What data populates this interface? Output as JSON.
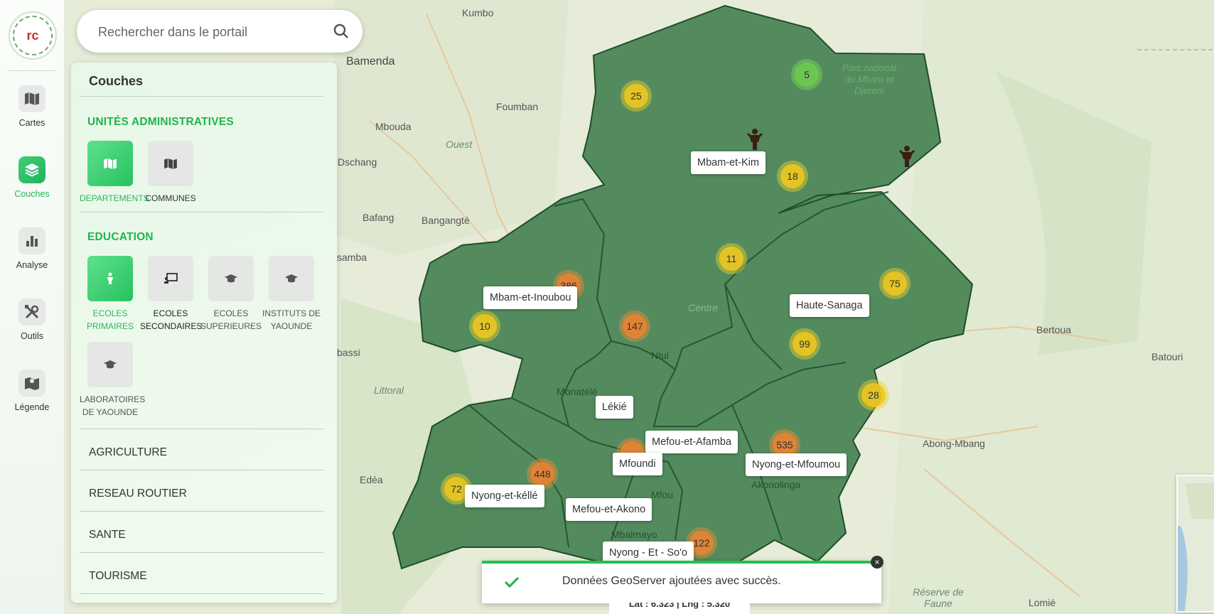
{
  "search": {
    "placeholder": "Rechercher dans le portail"
  },
  "nav": [
    {
      "label": "Cartes",
      "icon": "map-icon",
      "active": false
    },
    {
      "label": "Couches",
      "icon": "layers-icon",
      "active": true
    },
    {
      "label": "Analyse",
      "icon": "bar-chart-icon",
      "active": false
    },
    {
      "label": "Outils",
      "icon": "tools-icon",
      "active": false
    },
    {
      "label": "Légende",
      "icon": "legend-map-icon",
      "active": false
    }
  ],
  "panel": {
    "title": "Couches",
    "admin": {
      "title": "UNITÉS ADMINISTRATIVES",
      "items": [
        {
          "label": "DEPARTEMENTS",
          "icon": "map-icon",
          "active": true
        },
        {
          "label": "COMMUNES",
          "icon": "map-icon",
          "active": false
        }
      ]
    },
    "education": {
      "title": "EDUCATION",
      "items": [
        {
          "label": "ECOLES PRIMAIRES",
          "icon": "child-icon",
          "active": true
        },
        {
          "label": "ECOLES SECONDAIRES",
          "icon": "teacher-board-icon",
          "active": false
        },
        {
          "label": "ECOLES SUPERIEURES",
          "icon": "graduation-cap-icon",
          "active": false
        },
        {
          "label": "INSTITUTS DE YAOUNDE",
          "icon": "graduation-cap-icon",
          "active": false
        },
        {
          "label": "LABORATOIRES DE YAOUNDE",
          "icon": "graduation-cap-icon",
          "active": false
        }
      ]
    },
    "categories": [
      "AGRICULTURE",
      "RESEAU ROUTIER",
      "SANTE",
      "TOURISME"
    ]
  },
  "map": {
    "departments": [
      "Mbam-et-Kim",
      "Mbam-et-Inoubou",
      "Haute-Sanaga",
      "Lékié",
      "Mefou-et-Afamba",
      "Mfoundi",
      "Nyong-et-Mfoumou",
      "Nyong-et-kéllé",
      "Mefou-et-Akono",
      "Nyong - Et - So'o"
    ],
    "clusters": [
      {
        "value": "25",
        "level": "yellow"
      },
      {
        "value": "5",
        "level": "green"
      },
      {
        "value": "18",
        "level": "yellow"
      },
      {
        "value": "11",
        "level": "yellow"
      },
      {
        "value": "75",
        "level": "yellow"
      },
      {
        "value": "386",
        "level": "orange"
      },
      {
        "value": "10",
        "level": "yellow"
      },
      {
        "value": "147",
        "level": "orange"
      },
      {
        "value": "99",
        "level": "yellow"
      },
      {
        "value": "28",
        "level": "yellow"
      },
      {
        "value": "535",
        "level": "orange"
      },
      {
        "value": "448",
        "level": "orange"
      },
      {
        "value": "72",
        "level": "yellow"
      },
      {
        "value": "122",
        "level": "orange"
      }
    ],
    "places": [
      "Kumbo",
      "Bamenda",
      "Foumban",
      "Mbouda",
      "Ouest",
      "Dschang",
      "Bafang",
      "Bangangté",
      "samba",
      "bassi",
      "Littoral",
      "Edéa",
      "Monatélé",
      "Ntui",
      "Centre",
      "Mfou",
      "Mbalmayo",
      "Akonolinga",
      "Abong-Mbang",
      "Bertoua",
      "Batouri",
      "Lomié",
      "Réserve de Faune",
      "Parc national du Mbam et Djerem"
    ],
    "coords": "Lat : 6.323 | Lng : 5.320"
  },
  "toast": {
    "message": "Données GeoServer ajoutées avec succès.",
    "close": "×"
  }
}
